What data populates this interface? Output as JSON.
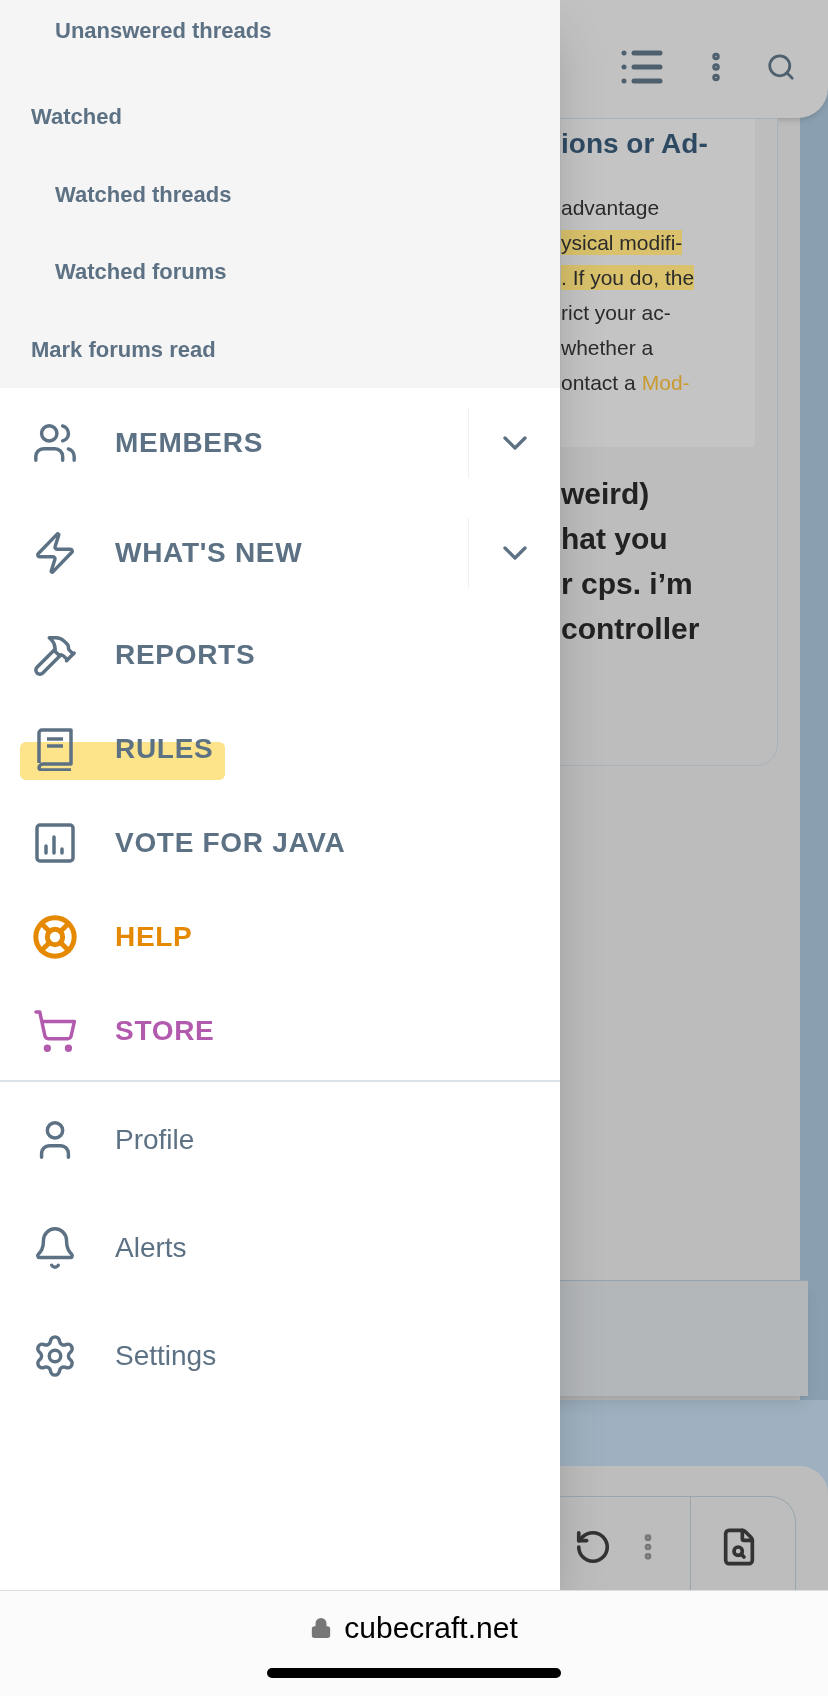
{
  "drawer": {
    "sub_links": [
      {
        "label": "Unanswered threads",
        "indented": true
      },
      {
        "label": "Watched",
        "indented": false
      },
      {
        "label": "Watched threads",
        "indented": true
      },
      {
        "label": "Watched forums",
        "indented": true
      },
      {
        "label": "Mark forums read",
        "indented": false
      }
    ],
    "nav_items": [
      {
        "label": "MEMBERS",
        "kind": "expandable",
        "expanded": false,
        "highlighted": false,
        "color": "#5c7184"
      },
      {
        "label": "WHAT'S NEW",
        "kind": "expandable",
        "expanded": false,
        "highlighted": false,
        "color": "#5c7184"
      },
      {
        "label": "REPORTS",
        "kind": "link",
        "highlighted": false,
        "color": "#5c7184"
      },
      {
        "label": "RULES",
        "kind": "link",
        "highlighted": true,
        "color": "#5c7184"
      },
      {
        "label": "VOTE FOR JAVA",
        "kind": "link",
        "highlighted": false,
        "color": "#5c7184"
      },
      {
        "label": "HELP",
        "kind": "link",
        "highlighted": false,
        "color": "#e58a00"
      },
      {
        "label": "STORE",
        "kind": "link",
        "highlighted": false,
        "color": "#b25aad"
      }
    ],
    "account_items": [
      {
        "label": "Profile"
      },
      {
        "label": "Alerts"
      },
      {
        "label": "Settings"
      }
    ]
  },
  "background": {
    "heading": "ions or Ad-",
    "rule_lines": [
      {
        "text": "advantage",
        "highlighted": false
      },
      {
        "text": "ysical modifi-",
        "highlighted": true
      },
      {
        "text": ". If you do, the",
        "highlighted": true
      },
      {
        "text": "rict your ac-",
        "highlighted": false
      },
      {
        "text": "whether a",
        "highlighted": false
      }
    ],
    "rule_last_line": "ontact a",
    "rule_link": "Mod-",
    "post_lines": [
      "weird)",
      "hat you",
      "r cps. i’m",
      "controller"
    ]
  },
  "browser": {
    "url": "cubecraft.net"
  }
}
